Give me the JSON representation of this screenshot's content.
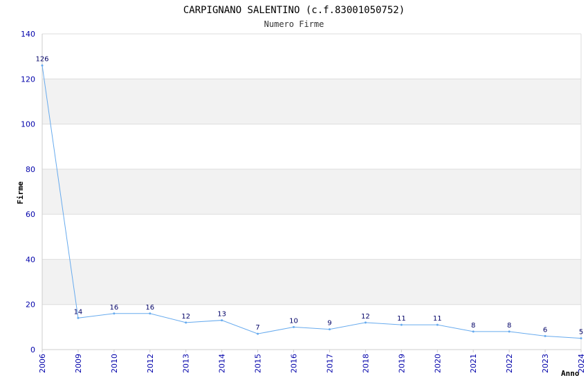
{
  "chart_data": {
    "type": "line",
    "title": "CARPIGNANO SALENTINO (c.f.83001050752)",
    "subtitle": "Numero Firme",
    "xlabel": "Anno",
    "ylabel": "Firme",
    "categories": [
      "2006",
      "2009",
      "2010",
      "2012",
      "2013",
      "2014",
      "2015",
      "2016",
      "2017",
      "2018",
      "2019",
      "2020",
      "2021",
      "2022",
      "2023",
      "2024"
    ],
    "series": [
      {
        "values": [
          126,
          14,
          16,
          16,
          12,
          13,
          7,
          10,
          9,
          12,
          11,
          11,
          8,
          8,
          6,
          5
        ]
      }
    ],
    "ylim": [
      0,
      140
    ],
    "yticks": [
      0,
      20,
      40,
      60,
      80,
      100,
      120,
      140
    ],
    "grid": true,
    "colors": {
      "line": "#66aaee",
      "band": "#f2f2f2",
      "tick": "#0000aa",
      "label": "#000066"
    }
  }
}
